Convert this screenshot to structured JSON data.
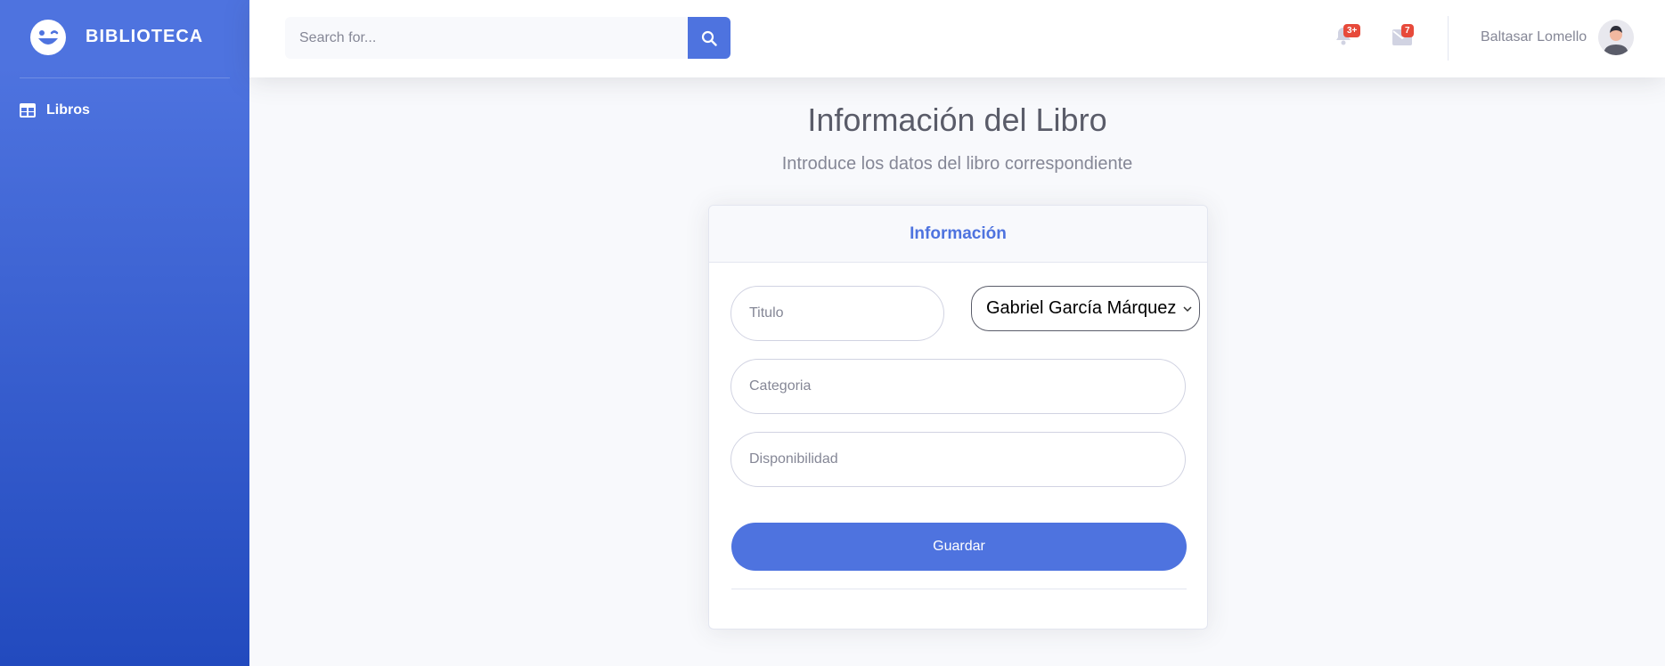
{
  "sidebar": {
    "brand": "BIBLIOTECA",
    "brand_icon": "laugh-wink-icon",
    "items": [
      {
        "label": "Libros",
        "icon": "table-icon"
      }
    ]
  },
  "topbar": {
    "search_placeholder": "Search for...",
    "search_icon": "search-icon",
    "alerts": {
      "icon": "bell-icon",
      "badge": "3+"
    },
    "messages": {
      "icon": "envelope-icon",
      "badge": "7"
    },
    "user_name": "Baltasar Lomello"
  },
  "main": {
    "title": "Información del Libro",
    "subtitle": "Introduce los datos del libro correspondiente",
    "card": {
      "header": "Información",
      "titulo_placeholder": "Titulo",
      "autor_selected": "Gabriel García Márquez",
      "categoria_placeholder": "Categoria",
      "disponibilidad_placeholder": "Disponibilidad",
      "save_label": "Guardar"
    }
  },
  "colors": {
    "primary": "#4e73df",
    "sidebar_gradient_end": "#224abe",
    "badge": "#e74a3b"
  }
}
